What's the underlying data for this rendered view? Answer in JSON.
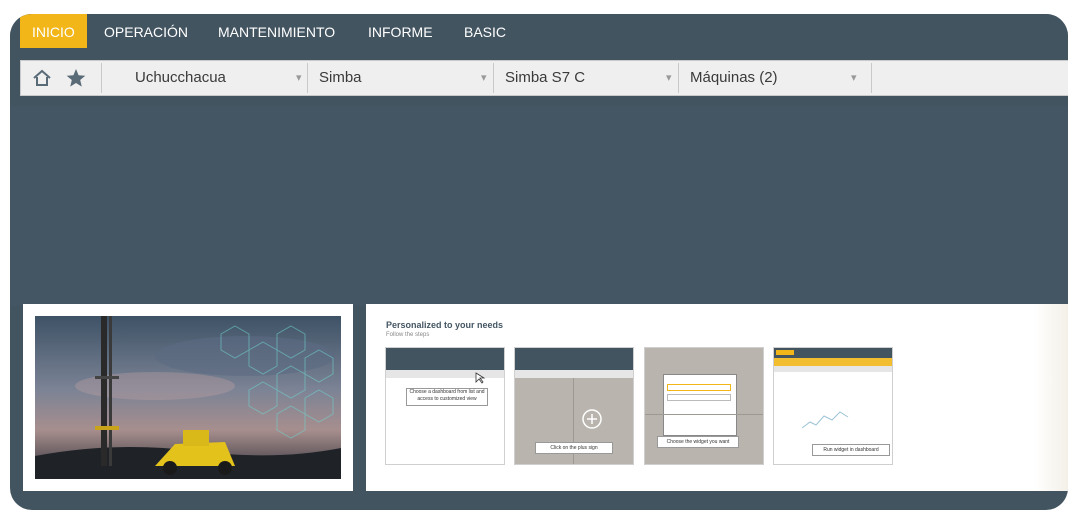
{
  "nav": {
    "tabs": [
      {
        "label": "INICIO",
        "active": true
      },
      {
        "label": "OPERACIÓN",
        "active": false
      },
      {
        "label": "MANTENIMIENTO",
        "active": false
      },
      {
        "label": "INFORME",
        "active": false
      },
      {
        "label": "BASIC",
        "active": false
      }
    ]
  },
  "toolbar": {
    "home_icon": "home-icon",
    "favorite_icon": "star-icon",
    "selectors": [
      {
        "value": "Uchucchacua"
      },
      {
        "value": "Simba"
      },
      {
        "value": "Simba S7 C"
      },
      {
        "value": "Máquinas (2)"
      }
    ]
  },
  "guide": {
    "title": "Personalized to your needs",
    "subtitle": "Follow the steps",
    "steps": [
      {
        "caption": "Choose a dashboard from list and access to customized view"
      },
      {
        "caption": "Click on the plus sign"
      },
      {
        "caption": "Choose the widget you want"
      },
      {
        "caption": "Run widget in dashboard"
      }
    ]
  },
  "colors": {
    "accent": "#f2b619",
    "header_bg": "#435461",
    "toolbar_bg": "#efefef"
  }
}
